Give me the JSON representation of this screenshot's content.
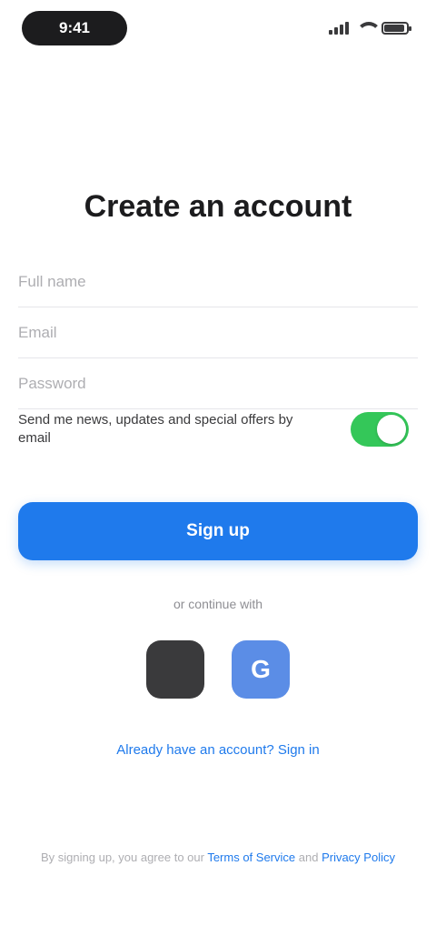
{
  "status_bar": {
    "time": "9:41",
    "battery_level": 0.9
  },
  "page": {
    "title": "Create an account"
  },
  "form": {
    "fields": [
      {
        "name": "full-name",
        "placeholder": "Full name",
        "value": ""
      },
      {
        "name": "email",
        "placeholder": "Email",
        "value": ""
      },
      {
        "name": "password",
        "placeholder": "Password",
        "value": ""
      }
    ],
    "newsletter_label": "Send me news, updates and special offers by email",
    "newsletter_enabled": true,
    "submit_label": "Sign up"
  },
  "social": {
    "divider_text": "or continue with",
    "apple_glyph": "",
    "google_glyph": "G"
  },
  "footer": {
    "signin_text": "Already have an account? Sign in",
    "legal_prefix": "By signing up, you agree to our ",
    "legal_terms": "Terms of Service",
    "legal_mid": " and ",
    "legal_privacy": "Privacy Policy"
  },
  "colors": {
    "accent": "#1f7aec",
    "toggle_on": "#34c759",
    "apple": "#3a3a3c",
    "google": "#5b8de6"
  }
}
